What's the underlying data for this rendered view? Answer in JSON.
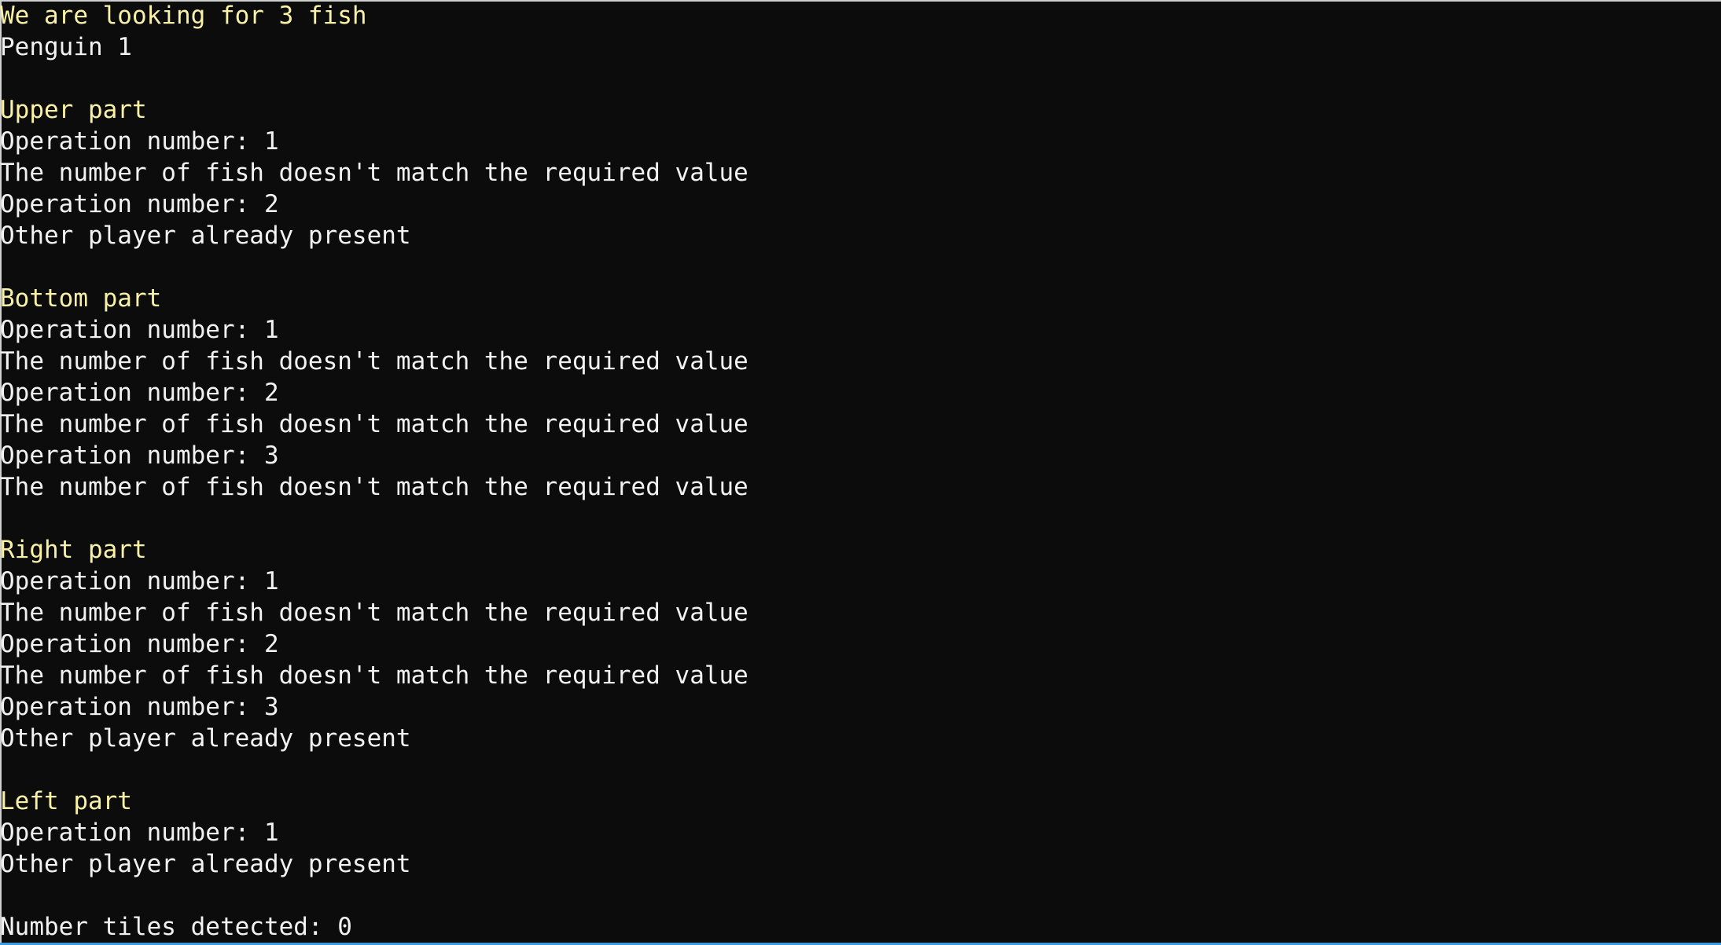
{
  "console": {
    "lines": [
      {
        "text": "We are looking for 3 fish",
        "highlight": true
      },
      {
        "text": "Penguin 1",
        "highlight": false
      },
      {
        "text": "",
        "highlight": false
      },
      {
        "text": "Upper part",
        "highlight": true
      },
      {
        "text": "Operation number: 1",
        "highlight": false
      },
      {
        "text": "The number of fish doesn't match the required value",
        "highlight": false
      },
      {
        "text": "Operation number: 2",
        "highlight": false
      },
      {
        "text": "Other player already present",
        "highlight": false
      },
      {
        "text": "",
        "highlight": false
      },
      {
        "text": "Bottom part",
        "highlight": true
      },
      {
        "text": "Operation number: 1",
        "highlight": false
      },
      {
        "text": "The number of fish doesn't match the required value",
        "highlight": false
      },
      {
        "text": "Operation number: 2",
        "highlight": false
      },
      {
        "text": "The number of fish doesn't match the required value",
        "highlight": false
      },
      {
        "text": "Operation number: 3",
        "highlight": false
      },
      {
        "text": "The number of fish doesn't match the required value",
        "highlight": false
      },
      {
        "text": "",
        "highlight": false
      },
      {
        "text": "Right part",
        "highlight": true
      },
      {
        "text": "Operation number: 1",
        "highlight": false
      },
      {
        "text": "The number of fish doesn't match the required value",
        "highlight": false
      },
      {
        "text": "Operation number: 2",
        "highlight": false
      },
      {
        "text": "The number of fish doesn't match the required value",
        "highlight": false
      },
      {
        "text": "Operation number: 3",
        "highlight": false
      },
      {
        "text": "Other player already present",
        "highlight": false
      },
      {
        "text": "",
        "highlight": false
      },
      {
        "text": "Left part",
        "highlight": true
      },
      {
        "text": "Operation number: 1",
        "highlight": false
      },
      {
        "text": "Other player already present",
        "highlight": false
      },
      {
        "text": "",
        "highlight": false
      },
      {
        "text": "Number tiles detected: 0",
        "highlight": false
      }
    ]
  },
  "colors": {
    "background": "#0c0c0c",
    "text": "#f2f2f2",
    "highlight_text": "#f9f1a5",
    "bottom_border": "#3b9ae0"
  }
}
